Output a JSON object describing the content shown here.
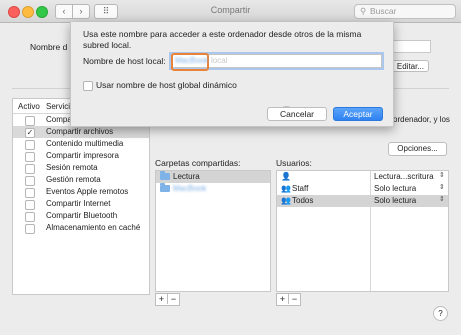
{
  "window": {
    "title": "Compartir",
    "search_placeholder": "Buscar"
  },
  "background": {
    "hostname_label": "Nombre d",
    "edit_button": "Editar...",
    "right_text": "ordenador, y los",
    "options_button": "Opciones...",
    "services_header": {
      "active": "Activo",
      "service": "Servici"
    },
    "services": [
      {
        "label": "Compa",
        "checked": false
      },
      {
        "label": "Compartir archivos",
        "checked": true
      },
      {
        "label": "Contenido multimedia",
        "checked": false
      },
      {
        "label": "Compartir impresora",
        "checked": false
      },
      {
        "label": "Sesión remota",
        "checked": false
      },
      {
        "label": "Gestión remota",
        "checked": false
      },
      {
        "label": "Eventos Apple remotos",
        "checked": false
      },
      {
        "label": "Compartir Internet",
        "checked": false
      },
      {
        "label": "Compartir Bluetooth",
        "checked": false
      },
      {
        "label": "Almacenamiento en caché",
        "checked": false
      }
    ],
    "shared_folders_label": "Carpetas compartidas:",
    "shared_folders": [
      {
        "name": "Lectura"
      },
      {
        "name": "MacBook"
      }
    ],
    "users_label": "Usuarios:",
    "users": [
      {
        "icon": "user-icon",
        "name": "",
        "permission": "Lectura...scritura"
      },
      {
        "icon": "group-icon",
        "name": "Staff",
        "permission": "Solo lectura"
      },
      {
        "icon": "group-icon",
        "name": "Todos",
        "permission": "Solo lectura"
      }
    ],
    "plus": "+",
    "minus": "−",
    "help": "?"
  },
  "sheet": {
    "message": "Usa este nombre para acceder a este ordenador desde otros de la misma subred local.",
    "host_label": "Nombre de host local:",
    "host_value": "MacBook",
    "host_suffix": "local",
    "global_checkbox_label": "Usar nombre de host global dinámico",
    "cancel_button": "Cancelar",
    "accept_button": "Aceptar",
    "help": "?"
  },
  "colors": {
    "accent": "#2f82f1",
    "highlight": "#e8843a"
  }
}
